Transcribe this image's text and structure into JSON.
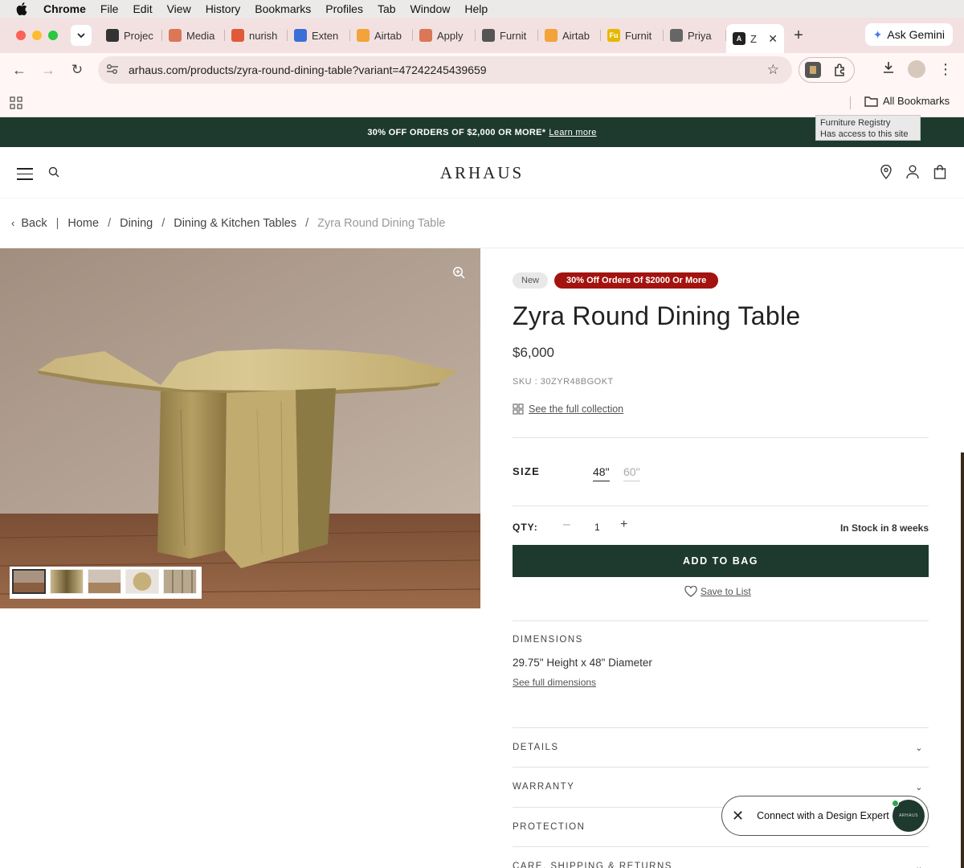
{
  "menubar": {
    "app": "Chrome",
    "items": [
      "File",
      "Edit",
      "View",
      "History",
      "Bookmarks",
      "Profiles",
      "Tab",
      "Window",
      "Help"
    ]
  },
  "tabs": [
    {
      "label": "Projec",
      "fav": "#333333",
      "icon": "openai-icon"
    },
    {
      "label": "Media",
      "fav": "#d97757",
      "icon": "claude-icon"
    },
    {
      "label": "nurish",
      "fav": "#e05a3a",
      "icon": "nurish-icon"
    },
    {
      "label": "Exten",
      "fav": "#3b6fd8",
      "icon": "puzzle-icon"
    },
    {
      "label": "Airtab",
      "fav": "#f2a33a",
      "icon": "airtable-icon"
    },
    {
      "label": "Apply",
      "fav": "#d97757",
      "icon": "claude-icon"
    },
    {
      "label": "Furnit",
      "fav": "#555555",
      "icon": "furniture-icon"
    },
    {
      "label": "Airtab",
      "fav": "#f2a33a",
      "icon": "airtable-icon"
    },
    {
      "label": "Furnit",
      "fav": "#e6b800",
      "icon": "fu-icon",
      "text": "Fu"
    },
    {
      "label": "Priya",
      "fav": "#666666",
      "icon": "globe-icon"
    },
    {
      "label": "Z",
      "fav": "#222222",
      "icon": "arhaus-icon",
      "text": "A",
      "active": true
    }
  ],
  "ask_gemini": "Ask Gemini",
  "url": "arhaus.com/products/zyra-round-dining-table?variant=47242245439659",
  "bookmarks": {
    "all": "All Bookmarks"
  },
  "tooltip": {
    "line1": "Furniture Registry",
    "line2": "Has access to this site"
  },
  "promo": {
    "text": "30% OFF ORDERS OF $2,000 OR MORE*",
    "link": "Learn more"
  },
  "site": {
    "logo": "ARHAUS"
  },
  "breadcrumb": {
    "back": "Back",
    "home": "Home",
    "dining": "Dining",
    "category": "Dining & Kitchen Tables",
    "current": "Zyra Round Dining Table"
  },
  "product": {
    "badge_new": "New",
    "badge_sale": "30% Off Orders Of $2000 Or More",
    "title": "Zyra Round Dining Table",
    "price": "$6,000",
    "sku": "SKU : 30ZYR48BGOKT",
    "collection_link": "See the full collection",
    "size_label": "SIZE",
    "sizes": [
      "48\"",
      "60\""
    ],
    "qty_label": "QTY:",
    "qty": "1",
    "stock": "In Stock in 8 weeks",
    "add_to_bag": "ADD TO BAG",
    "save_to_list": "Save to List",
    "dimensions_label": "DIMENSIONS",
    "dimensions_value": "29.75\" Height x 48\" Diameter",
    "dimensions_link": "See full dimensions",
    "accordions": [
      "DETAILS",
      "WARRANTY",
      "PROTECTION",
      "CARE, SHIPPING & RETURNS"
    ]
  },
  "chat": {
    "label": "Connect with a Design Expert",
    "avatar_text": "ARHAUS"
  },
  "colors": {
    "brand_green": "#1e3a2f",
    "sale_red": "#a3130f"
  }
}
